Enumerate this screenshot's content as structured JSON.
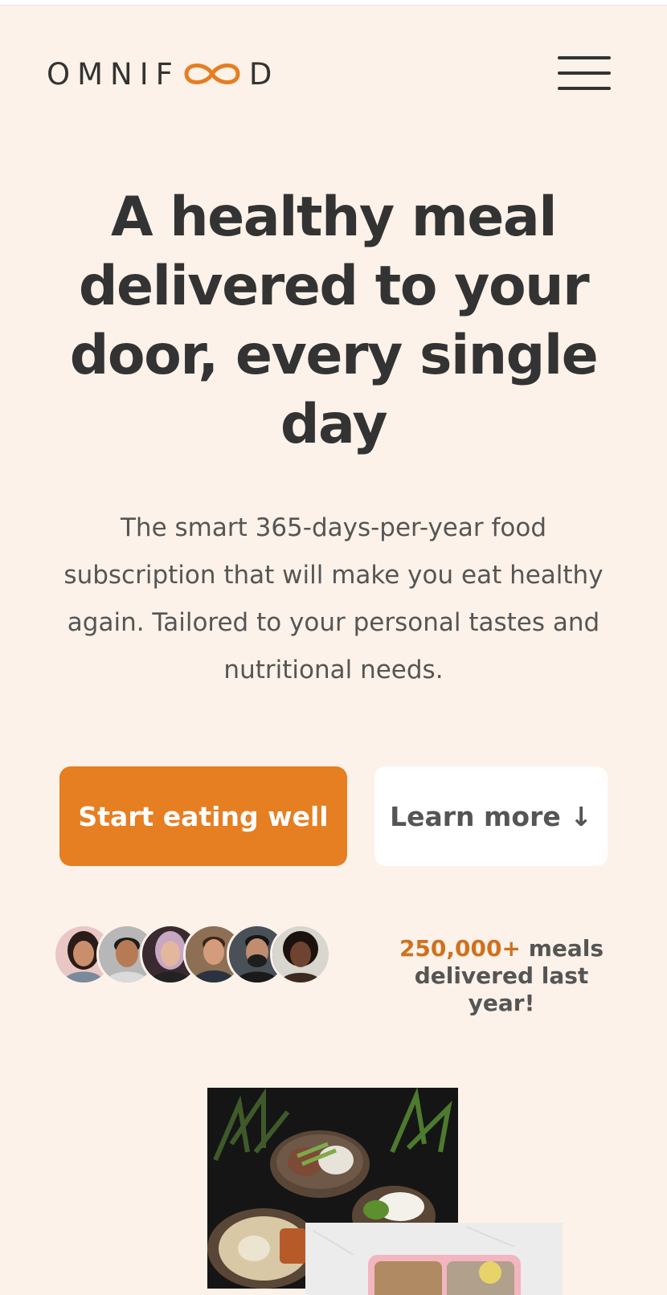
{
  "colors": {
    "background": "#fdf2e9",
    "brand": "#e67e22",
    "brand_dark": "#cf711f",
    "text": "#333333",
    "text_muted": "#555555"
  },
  "header": {
    "logo_left": "OMNIF",
    "logo_right": "D",
    "logo_icon": "infinity-icon",
    "menu_icon": "hamburger-menu-icon"
  },
  "hero": {
    "title": "A healthy meal delivered to your door, every single day",
    "description": "The smart 365-days-per-year food subscription that will make you eat healthy again. Tailored to your personal tastes and nutritional needs.",
    "primary_cta": "Start eating well",
    "secondary_cta": "Learn more ↓"
  },
  "delivered": {
    "count": "250,000+",
    "text": " meals delivered last year!",
    "customer_count": 6
  }
}
